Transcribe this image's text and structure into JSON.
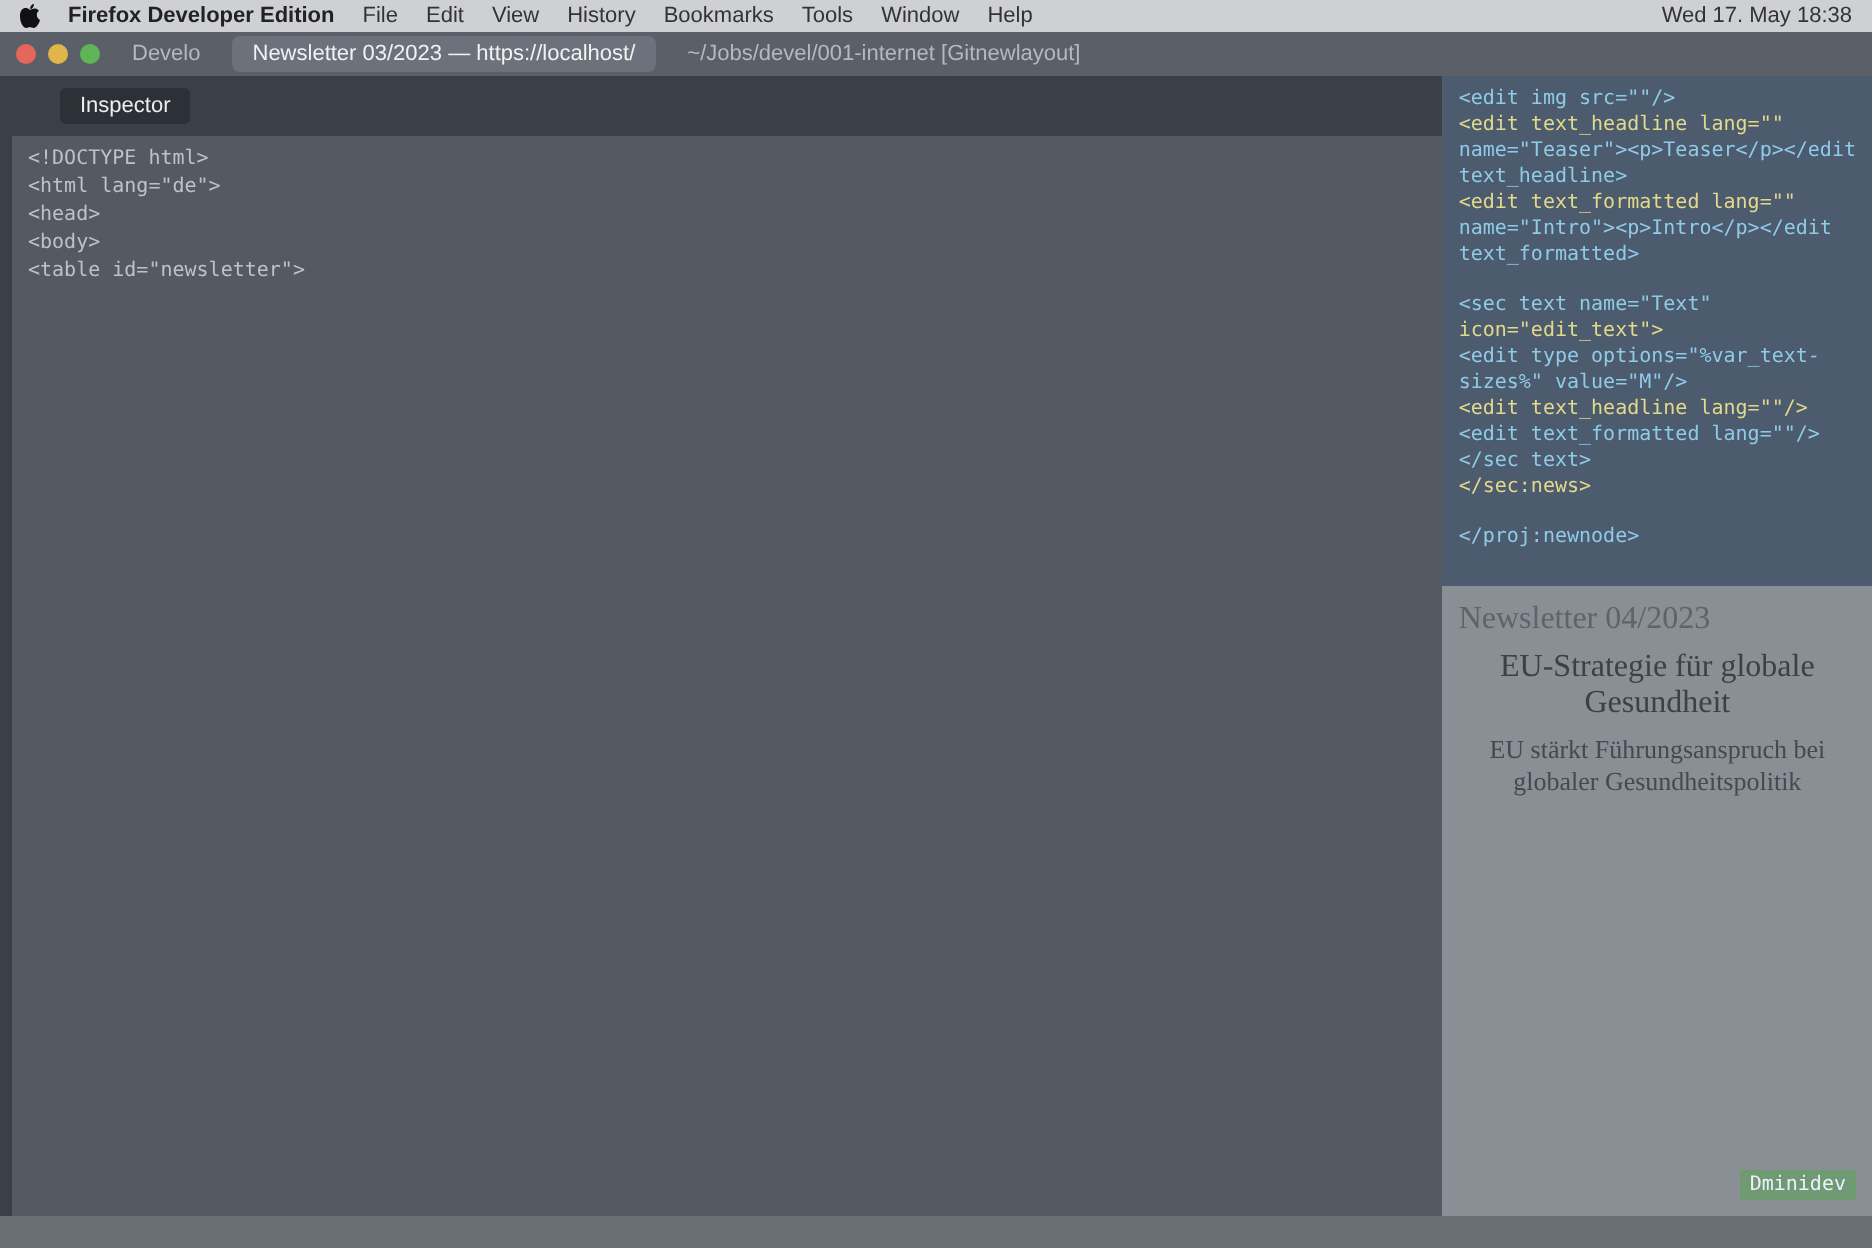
{
  "menu_bar": {
    "app": "Firefox Developer Edition",
    "items": [
      "File",
      "Edit",
      "View",
      "History",
      "Bookmarks",
      "Tools",
      "Window",
      "Help"
    ],
    "clock": "Wed 17. May 18:38"
  },
  "window_tabs": [
    {
      "title": "Develo",
      "selected": false
    },
    {
      "title": "Newsletter 03/2023 — https://localhost/",
      "selected": true
    },
    {
      "title": "~/Jobs/devel/001-internet [Gitnewlayout]",
      "selected": false
    }
  ],
  "devtools": {
    "tab": "Inspector",
    "code_lines": [
      "<!DOCTYPE html>",
      "<html lang=\"de\">",
      "<head>",
      "<body>",
      "<table id=\"newsletter\">"
    ]
  },
  "editor": {
    "code_blocks": [
      [
        "<edit img src=\"\"/>",
        "<edit text_headline lang=\"\"",
        "name=\"Teaser\"><p>Teaser</p></edit",
        "text_headline>",
        "<edit text_formatted lang=\"\"",
        "name=\"Intro\"><p>Intro</p></edit",
        "text_formatted>"
      ],
      [
        "<sec text name=\"Text\"",
        "icon=\"edit_text\">",
        "<edit type options=\"%var_text-",
        "sizes%\" value=\"M\"/>",
        "<edit text_headline lang=\"\"/>",
        "<edit text_formatted lang=\"\"/>",
        "</sec text>",
        "</sec:news>"
      ],
      [
        "</proj:newnode>"
      ]
    ]
  },
  "article": {
    "date": "Newsletter 04/2023",
    "headline": "EU-Strategie für globale Gesundheit",
    "subheadline": "EU stärkt Führungsanspruch bei globaler Gesundheitspolitik",
    "status_tag": "Dminidev"
  }
}
